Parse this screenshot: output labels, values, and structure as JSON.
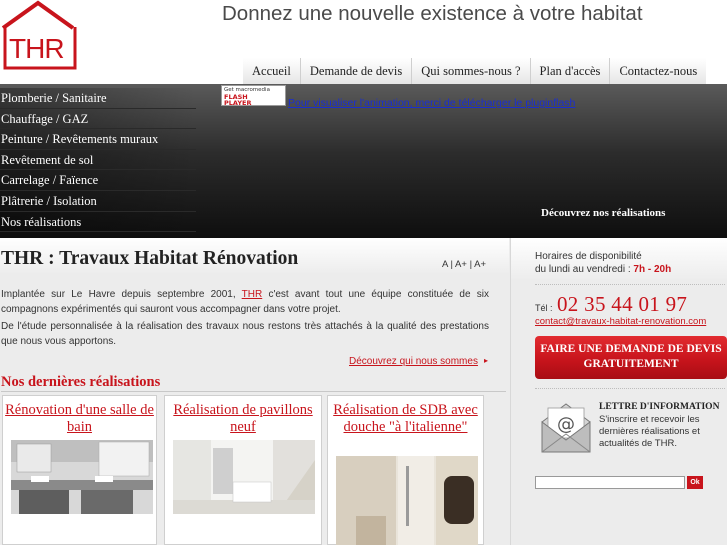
{
  "header": {
    "logo_text": "THR",
    "slogan": "Donnez une nouvelle existence à votre habitat"
  },
  "topnav": [
    {
      "label": "Accueil"
    },
    {
      "label": "Demande de devis"
    },
    {
      "label": "Qui sommes-nous ?"
    },
    {
      "label": "Plan d'accès"
    },
    {
      "label": "Contactez-nous"
    }
  ],
  "sidenav": [
    {
      "label": "Plomberie / Sanitaire"
    },
    {
      "label": "Chauffage / GAZ"
    },
    {
      "label": "Peinture / Revêtements muraux"
    },
    {
      "label": "Revêtement de sol"
    },
    {
      "label": "Carrelage / Faïence"
    },
    {
      "label": "Plâtrerie / Isolation"
    },
    {
      "label": "Nos réalisations"
    }
  ],
  "flash": {
    "badge_line1": "Get macromedia",
    "badge_line2": "FLASH",
    "badge_line3": "PLAYER",
    "link": "Pour visualiser l'animation, merci de télécharger le pluginflash"
  },
  "band": {
    "cta": "Découvrez nos réalisations"
  },
  "main": {
    "title": "THR : Travaux Habitat Rénovation",
    "font_size_a": "A",
    "font_size_a_plus": "A+",
    "font_size_a_plus2": "A+",
    "p1_before": "Implantée sur Le Havre depuis septembre 2001, ",
    "p1_link": "THR",
    "p1_after": " c'est avant tout une équipe constituée de six compagnons expérimentés qui sauront vous accompagner dans votre projet.",
    "p2": "De l'étude personnalisée à la réalisation des travaux nous restons très attachés à la qualité des prestations que nous vous apportons.",
    "more_link": "Découvrez qui nous sommes",
    "latest_title": "Nos dernières réalisations",
    "cards": [
      {
        "title": "Rénovation d'une salle de bain"
      },
      {
        "title": "Réalisation de pavillons neuf"
      },
      {
        "title": "Réalisation de SDB avec douche \"à l'italienne\""
      }
    ]
  },
  "sidebar": {
    "hours_line1": "Horaires de disponibilité",
    "hours_line2_prefix": "du lundi au vendredi : ",
    "hours_line2_value": "7h - 20h",
    "tel_label": "Tél :",
    "tel_number": "02 35 44 01 97",
    "email": "contact@travaux-habitat-renovation.com",
    "quote_button": "FAIRE UNE DEMANDE DE DEVIS GRATUITEMENT",
    "newsletter_title": "LETTRE D'INFORMATION",
    "newsletter_desc": "S'inscrire et recevoir les dernières réalisations et actualités de THR.",
    "ok_label": "Ok"
  },
  "colors": {
    "brand_red": "#c8141c",
    "link_blue": "#1a2ed0",
    "band_dark": "#111111"
  }
}
